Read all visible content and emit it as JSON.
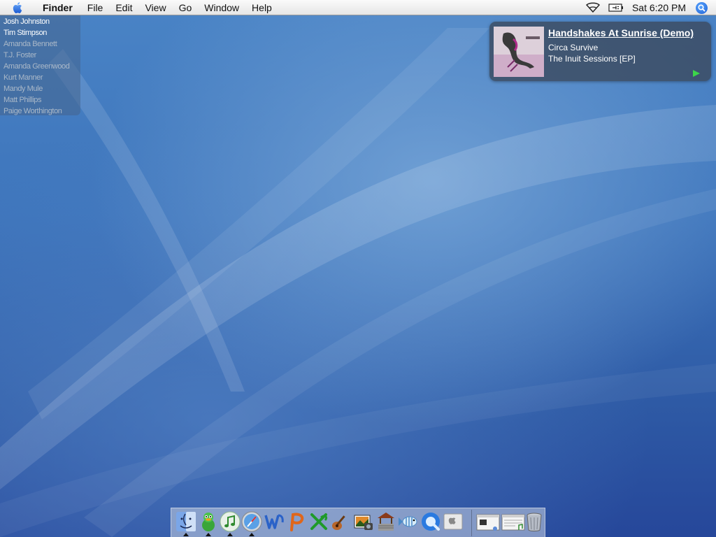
{
  "menubar": {
    "app_name": "Finder",
    "menus": [
      "File",
      "Edit",
      "View",
      "Go",
      "Window",
      "Help"
    ],
    "clock": "Sat 6:20 PM",
    "icons": [
      "apple-icon",
      "wifi-icon",
      "battery-icon",
      "spotlight-icon"
    ]
  },
  "buddy_list": {
    "buddies": [
      {
        "name": "Josh Johnston",
        "online": true
      },
      {
        "name": "Tim Stimpson",
        "online": true
      },
      {
        "name": "Amanda Bennett",
        "online": false
      },
      {
        "name": "T.J. Foster",
        "online": false
      },
      {
        "name": "Amanda Greenwood",
        "online": false
      },
      {
        "name": "Kurt Manner",
        "online": false
      },
      {
        "name": "Mandy Mule",
        "online": false
      },
      {
        "name": "Matt Phillips",
        "online": false
      },
      {
        "name": "Paige Worthington",
        "online": false
      }
    ]
  },
  "now_playing": {
    "title": "Handshakes At Sunrise (Demo)",
    "artist": "Circa Survive",
    "album": "The Inuit Sessions [EP]"
  },
  "dock": {
    "apps": [
      "finder-icon",
      "adium-icon",
      "itunes-icon",
      "safari-icon",
      "word-icon",
      "powerpoint-icon",
      "excel-icon",
      "garageband-icon",
      "iphoto-icon",
      "wishing-well-icon",
      "fish-icon",
      "quicktime-icon",
      "apple-system-icon"
    ],
    "docs": [
      "window-minimized-icon",
      "music-document-icon",
      "trash-icon"
    ],
    "running": [
      "finder-icon",
      "adium-icon",
      "itunes-icon",
      "safari-icon"
    ]
  },
  "colors": {
    "wallpaper": "#3d74bb",
    "menubar": "#eeeeee",
    "play_button": "#3cd64a"
  }
}
